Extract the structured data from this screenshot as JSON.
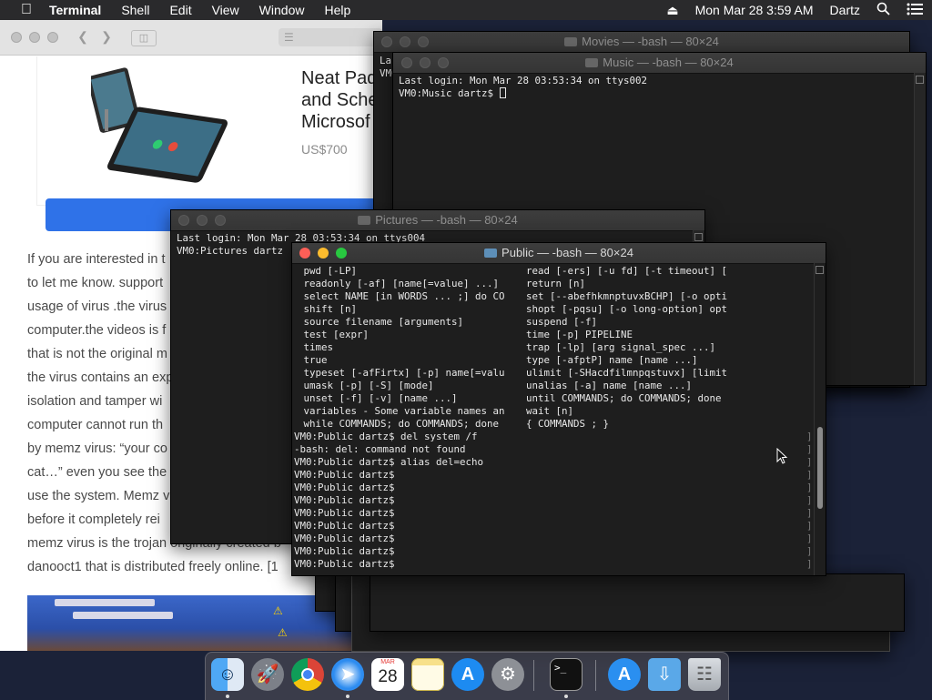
{
  "menubar": {
    "app": "Terminal",
    "items": [
      "Shell",
      "Edit",
      "View",
      "Window",
      "Help"
    ],
    "clock": "Mon Mar 28  3:59 AM",
    "user": "Dartz"
  },
  "browser": {
    "product_title_lines": [
      "Neat Pad",
      "and Sche",
      "Microsof"
    ],
    "price": "US$700",
    "article_lines": [
      "If you are interested in t",
      "to let me know. support",
      "usage of virus .the virus",
      "computer.the videos is f",
      "that is not the original m",
      "the virus contains an exp",
      "isolation and tamper wi",
      "computer cannot run th",
      "by memz virus: “your co",
      "cat…” even you see the",
      "use the system. Memz v",
      "before it completely rei",
      "memz virus is the trojan originally created b",
      "danooct1 that is distributed freely online. [1"
    ]
  },
  "windows": {
    "movies": {
      "title": "Movies — -bash — 80×24",
      "lines": [
        "Las",
        "VM0"
      ]
    },
    "music": {
      "title": "Music — -bash — 80×24",
      "lines": [
        "Last login: Mon Mar 28 03:53:34 on ttys002",
        "VM0:Music dartz$ "
      ]
    },
    "pictures": {
      "title": "Pictures — -bash — 80×24",
      "lines": [
        "Last login: Mon Mar 28 03:53:34 on ttys004",
        "VM0:Pictures dartz"
      ]
    },
    "public": {
      "title": "Public — -bash — 80×24",
      "left_col": [
        " pwd [-LP]",
        " readonly [-af] [name[=value] ...]",
        " select NAME [in WORDS ... ;] do CO",
        " shift [n]",
        " source filename [arguments]",
        " test [expr]",
        " times",
        " true",
        " typeset [-afFirtx] [-p] name[=valu",
        " umask [-p] [-S] [mode]",
        " unset [-f] [-v] [name ...]",
        " variables - Some variable names an",
        " while COMMANDS; do COMMANDS; done"
      ],
      "right_col": [
        "read [-ers] [-u fd] [-t timeout] [",
        "return [n]",
        "set [--abefhkmnptuvxBCHP] [-o opti",
        "shopt [-pqsu] [-o long-option] opt",
        "suspend [-f]",
        "time [-p] PIPELINE",
        "trap [-lp] [arg signal_spec ...]",
        "type [-afptP] name [name ...]",
        "ulimit [-SHacdfilmnpqstuvx] [limit",
        "unalias [-a] name [name ...]",
        "until COMMANDS; do COMMANDS; done",
        "wait [n]",
        "{ COMMANDS ; }"
      ],
      "session": [
        "VM0:Public dartz$ del system /f",
        "-bash: del: command not found",
        "VM0:Public dartz$ alias del=echo",
        "VM0:Public dartz$",
        "VM0:Public dartz$",
        "VM0:Public dartz$",
        "VM0:Public dartz$",
        "VM0:Public dartz$",
        "VM0:Public dartz$",
        "VM0:Public dartz$",
        "VM0:Public dartz$"
      ]
    }
  },
  "dock": {
    "apps": [
      "Finder",
      "Launchpad",
      "Chrome",
      "Safari",
      "Calendar",
      "Notes",
      "App Store",
      "System Preferences",
      "Terminal",
      "Applications",
      "Downloads",
      "Trash"
    ],
    "calendar_month": "MAR",
    "calendar_day": "28",
    "terminal_glyph": ">_"
  }
}
